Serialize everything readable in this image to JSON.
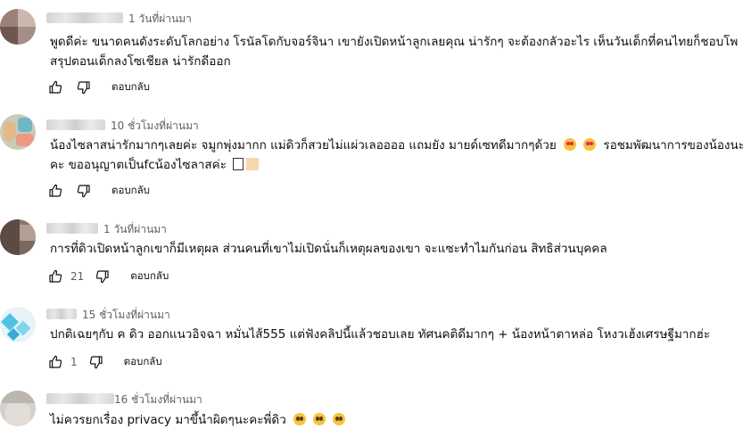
{
  "comments": [
    {
      "time": "1 วันที่ผ่านมา",
      "text_line1": "พูดดีค่ะ ขนาดคนดังระดับโลกอย่าง โรนัลโดกับจอร์จินา เขายังเปิดหน้าลูกเลยคุณ น่ารักๆ จะต้องกลัวอะไร เห็นวันเด็กที่คนไทยก็ชอบโพ",
      "text_line2": "สรุปตอนเด็กลงโซเชียล น่ารักดีออก",
      "likes": "",
      "reply_label": "ตอบกลับ"
    },
    {
      "time": "10 ชั่วโมงที่ผ่านมา",
      "text_line1": "น้องไซลาสน่ารักมากๆเลยค่ะ จมูกพุ่งมากก แม่ดิวก็สวยไม่แผ่วเลออออ แถมยัง มายด์เซทดีมากๆด้วย",
      "text_line1b": "รอชมพัฒนาการของน้องนะ",
      "text_line2": "คะ ขออนุญาตเป็นfcน้องไซลาสค่ะ",
      "likes": "",
      "reply_label": "ตอบกลับ"
    },
    {
      "time": "1 วันที่ผ่านมา",
      "text_line1": "การที่ดิวเปิดหน้าลูกเขาก็มีเหตุผล ส่วนคนที่เขาไม่เปิดนั่นก็เหตุผลของเขา จะแซะทำไมกันก่อน สิทธิส่วนบุคคล",
      "likes": "21",
      "reply_label": "ตอบกลับ"
    },
    {
      "time": "15 ชั่วโมงที่ผ่านมา",
      "text_line1": "ปกติเฉยๆกับ ค ดิว ออกแนวอิจฉา หมั่นไส้555  แต่ฟังคลิปนี้แล้วชอบเลย ทัศนคติดีมากๆ + น้องหน้าตาหล่อ โหงวเฮ้งเศรษฐีมากฮ่ะ",
      "likes": "1",
      "reply_label": "ตอบกลับ"
    },
    {
      "time": "16 ชั่วโมงที่ผ่านมา",
      "text_line1": "ไม่ควรยกเรื่อง privacy มาขึ้นำผิดๆนะคะพี่ดิว",
      "likes": "",
      "reply_label": ""
    }
  ],
  "icons": {
    "like": "thumbs-up-icon",
    "dislike": "thumbs-down-icon",
    "emoji_heart_eyes": "heart-eyes-emoji-icon",
    "emoji_pleading": "pleading-face-emoji-icon"
  },
  "colors": {
    "text": "#0f0f0f",
    "meta": "#606060"
  }
}
